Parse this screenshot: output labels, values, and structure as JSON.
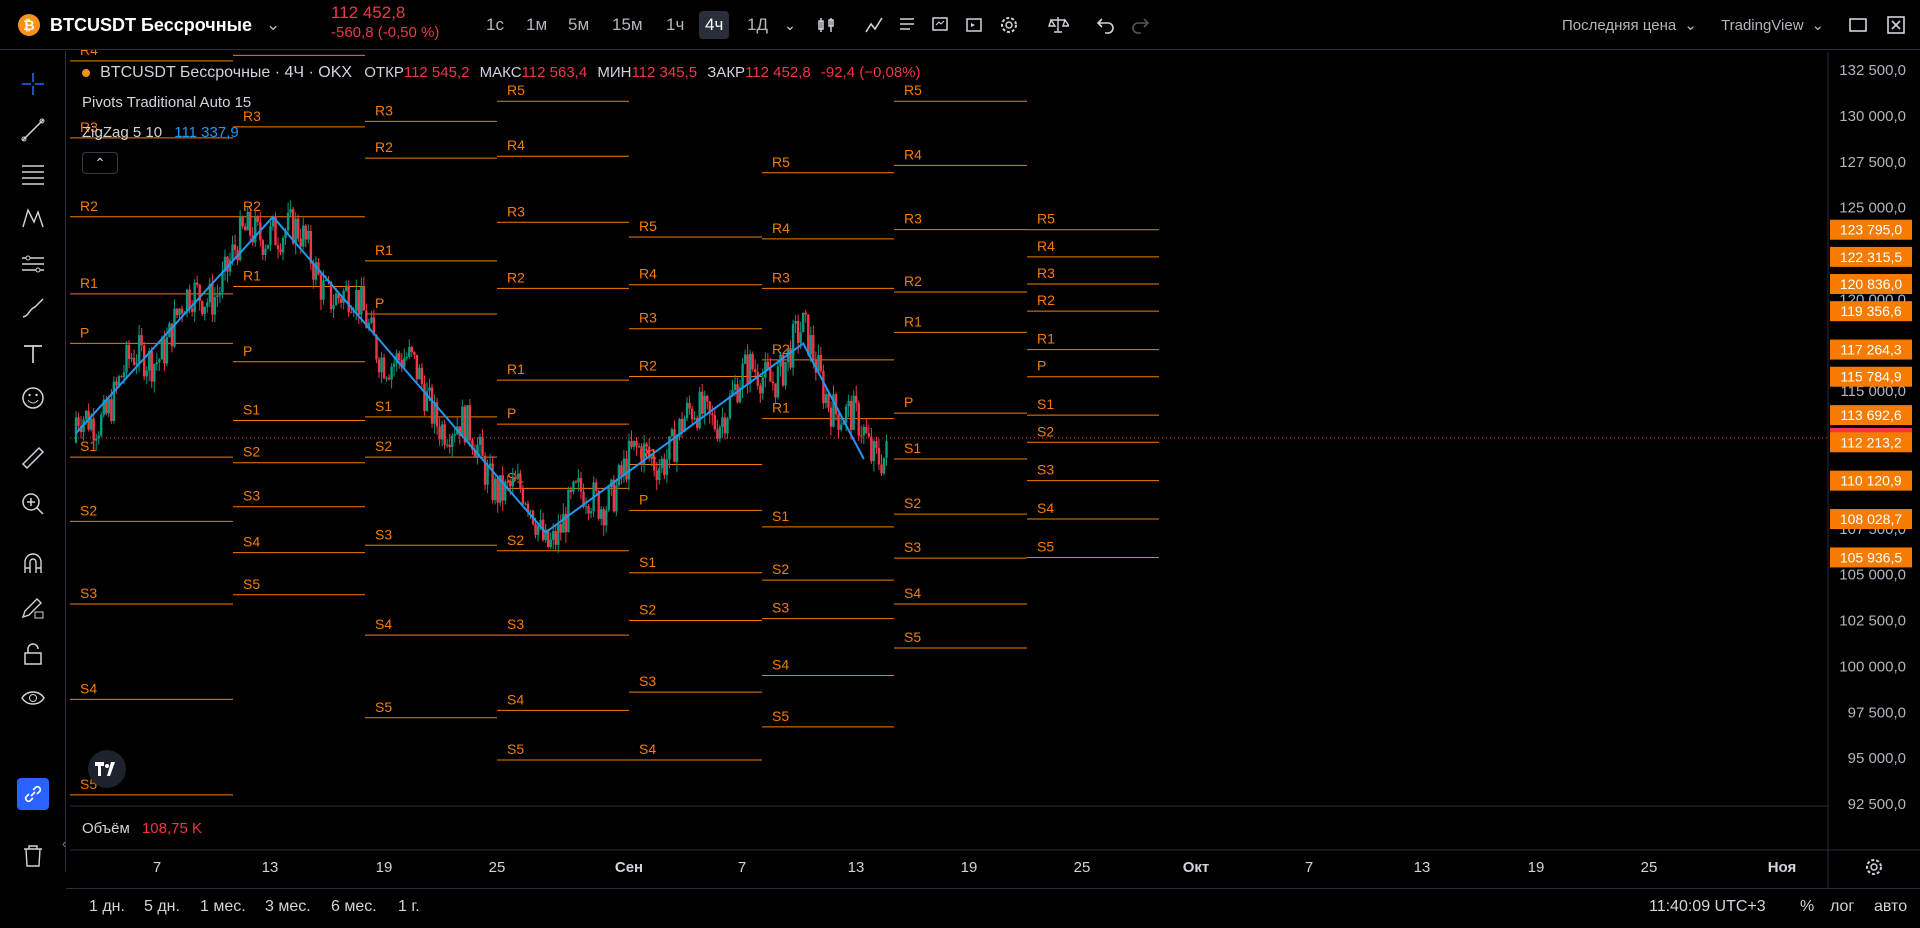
{
  "header": {
    "symbol": "BTCUSDT Бессрочные",
    "price": "112 452,8",
    "change": "-560,8 (-0,50 %)",
    "timeframes": [
      "1с",
      "1м",
      "5м",
      "15м",
      "1ч",
      "4ч",
      "1Д"
    ],
    "active_timeframe": "4ч",
    "price_type": "Последняя цена",
    "source": "TradingView"
  },
  "legend": {
    "title": "BTCUSDT Бессрочные · 4Ч · OKX",
    "open_label": "ОТКР",
    "open": "112 545,2",
    "high_label": "МАКС",
    "high": "112 563,4",
    "low_label": "МИН",
    "low": "112 345,5",
    "close_label": "ЗАКР",
    "close": "112 452,8",
    "change": "-92,4 (−0,08%)",
    "pivots": "Pivots Traditional Auto 15",
    "zigzag": "ZigZag 5 10",
    "zigzag_value": "111 337,9"
  },
  "volume": {
    "label": "Объём",
    "value": "108,75 K"
  },
  "bottom": {
    "ranges": [
      "1 дн.",
      "5 дн.",
      "1 мес.",
      "3 мес.",
      "6 мес.",
      "1 г."
    ],
    "time": "11:40:09 UTC+3",
    "percent": "%",
    "log": "лог",
    "auto": "авто"
  },
  "chart_data": {
    "type": "candlestick",
    "title": "BTCUSDT Бессрочные · 4Ч · OKX",
    "y_axis_labels": [
      132500,
      130000,
      127500,
      125000,
      122500,
      120000,
      117500,
      115000,
      112500,
      110000,
      107500,
      105000,
      102500,
      100000,
      97500,
      95000,
      92500
    ],
    "ylim": [
      92500,
      133500
    ],
    "x_ticks": [
      "7",
      "13",
      "19",
      "25",
      "Сен",
      "7",
      "13",
      "19",
      "25",
      "Окт",
      "7",
      "13",
      "19",
      "25",
      "Ноя"
    ],
    "last_price": 112452.8,
    "price_badges": [
      {
        "value": "123 795,0",
        "color": "#f57c00"
      },
      {
        "value": "122 315,5",
        "color": "#f57c00"
      },
      {
        "value": "120 836,0",
        "color": "#f57c00"
      },
      {
        "value": "119 356,6",
        "color": "#f57c00"
      },
      {
        "value": "117 264,3",
        "color": "#f57c00"
      },
      {
        "value": "115 784,9",
        "color": "#f57c00"
      },
      {
        "value": "113 692,6",
        "color": "#f57c00"
      },
      {
        "value": "112 452,8",
        "color": "#f23645"
      },
      {
        "value": "112 213,2",
        "color": "#f57c00"
      },
      {
        "value": "110 120,9",
        "color": "#f57c00"
      },
      {
        "value": "108 028,7",
        "color": "#f57c00"
      },
      {
        "value": "105 936,5",
        "color": "#f57c00"
      }
    ],
    "zigzag": [
      {
        "x": "Aug 1",
        "y": 112700
      },
      {
        "x": "Aug 14",
        "y": 124500
      },
      {
        "x": "Sep 1",
        "y": 107300
      },
      {
        "x": "Sep 18",
        "y": 117600
      },
      {
        "x": "Sep 22",
        "y": 111300
      }
    ],
    "pivot_periods": [
      {
        "levels": [
          {
            "name": "R4",
            "value": 133000
          },
          {
            "name": "R3",
            "value": 128800
          },
          {
            "name": "R2",
            "value": 124500
          },
          {
            "name": "R1",
            "value": 120300
          },
          {
            "name": "P",
            "value": 117600
          },
          {
            "name": "S1",
            "value": 111400
          },
          {
            "name": "S2",
            "value": 107900
          },
          {
            "name": "S3",
            "value": 103400
          },
          {
            "name": "S4",
            "value": 98200
          },
          {
            "name": "S5",
            "value": 93000
          }
        ]
      },
      {
        "levels": [
          {
            "name": "R4",
            "value": 133300
          },
          {
            "name": "R3",
            "value": 129400
          },
          {
            "name": "R2",
            "value": 124500
          },
          {
            "name": "R1",
            "value": 120700
          },
          {
            "name": "P",
            "value": 116600
          },
          {
            "name": "S1",
            "value": 113400
          },
          {
            "name": "S2",
            "value": 111100
          },
          {
            "name": "S3",
            "value": 108700
          },
          {
            "name": "S4",
            "value": 106200
          },
          {
            "name": "S5",
            "value": 103900
          }
        ]
      },
      {
        "levels": [
          {
            "name": "R3",
            "value": 129700
          },
          {
            "name": "R2",
            "value": 127700
          },
          {
            "name": "R1",
            "value": 122100
          },
          {
            "name": "P",
            "value": 119200
          },
          {
            "name": "S1",
            "value": 113600
          },
          {
            "name": "S2",
            "value": 111400
          },
          {
            "name": "S3",
            "value": 106600
          },
          {
            "name": "S4",
            "value": 101700
          },
          {
            "name": "S5",
            "value": 97200
          }
        ]
      },
      {
        "levels": [
          {
            "name": "R5",
            "value": 130800
          },
          {
            "name": "R4",
            "value": 127800
          },
          {
            "name": "R3",
            "value": 124200
          },
          {
            "name": "R2",
            "value": 120600
          },
          {
            "name": "R1",
            "value": 115600
          },
          {
            "name": "P",
            "value": 113200
          },
          {
            "name": "S1",
            "value": 109700
          },
          {
            "name": "S2",
            "value": 106300
          },
          {
            "name": "S3",
            "value": 101700
          },
          {
            "name": "S4",
            "value": 97600
          },
          {
            "name": "S5",
            "value": 94900
          }
        ]
      },
      {
        "levels": [
          {
            "name": "R5",
            "value": 123400
          },
          {
            "name": "R4",
            "value": 120800
          },
          {
            "name": "R3",
            "value": 118400
          },
          {
            "name": "R2",
            "value": 115800
          },
          {
            "name": "R1",
            "value": 111000
          },
          {
            "name": "P",
            "value": 108500
          },
          {
            "name": "S1",
            "value": 105100
          },
          {
            "name": "S2",
            "value": 102500
          },
          {
            "name": "S3",
            "value": 98600
          },
          {
            "name": "S4",
            "value": 94900
          }
        ]
      },
      {
        "levels": [
          {
            "name": "R5",
            "value": 126900
          },
          {
            "name": "R4",
            "value": 123300
          },
          {
            "name": "R3",
            "value": 120600
          },
          {
            "name": "R2",
            "value": 116700
          },
          {
            "name": "R1",
            "value": 113500
          },
          {
            "name": "S1",
            "value": 107600
          },
          {
            "name": "S2",
            "value": 104700
          },
          {
            "name": "S3",
            "value": 102600
          },
          {
            "name": "S4",
            "value": 99500
          },
          {
            "name": "S5",
            "value": 96700
          }
        ]
      },
      {
        "levels": [
          {
            "name": "R5",
            "value": 130800
          },
          {
            "name": "R4",
            "value": 127300
          },
          {
            "name": "R3",
            "value": 123800
          },
          {
            "name": "R2",
            "value": 120400
          },
          {
            "name": "R1",
            "value": 118200
          },
          {
            "name": "P",
            "value": 113800
          },
          {
            "name": "S1",
            "value": 111300
          },
          {
            "name": "S2",
            "value": 108300
          },
          {
            "name": "S3",
            "value": 105900
          },
          {
            "name": "S4",
            "value": 103400
          },
          {
            "name": "S5",
            "value": 101000
          }
        ]
      },
      {
        "levels": [
          {
            "name": "R5",
            "value": 123795.0
          },
          {
            "name": "R4",
            "value": 122315.5
          },
          {
            "name": "R3",
            "value": 120836.0
          },
          {
            "name": "R2",
            "value": 119356.6
          },
          {
            "name": "R1",
            "value": 117264.3
          },
          {
            "name": "P",
            "value": 115784.9
          },
          {
            "name": "S1",
            "value": 113692.6
          },
          {
            "name": "S2",
            "value": 112213.2
          },
          {
            "name": "S3",
            "value": 110120.9
          },
          {
            "name": "S4",
            "value": 108028.7
          },
          {
            "name": "S5",
            "value": 105936.5
          }
        ]
      }
    ]
  },
  "colors": {
    "up": "#089981",
    "down": "#f23645",
    "pivot": "#f57c00",
    "zigzag": "#2196f3",
    "badge": "#f57c00"
  },
  "icons": [
    "crosshair-icon",
    "trend-line-icon",
    "fib-icon",
    "pattern-icon",
    "forecast-icon",
    "brush-icon",
    "text-icon",
    "emoji-icon",
    "ruler-icon",
    "zoom-icon",
    "magnet-icon",
    "lock-draw-icon",
    "lock-icon",
    "eye-icon",
    "link-icon",
    "trash-icon"
  ]
}
